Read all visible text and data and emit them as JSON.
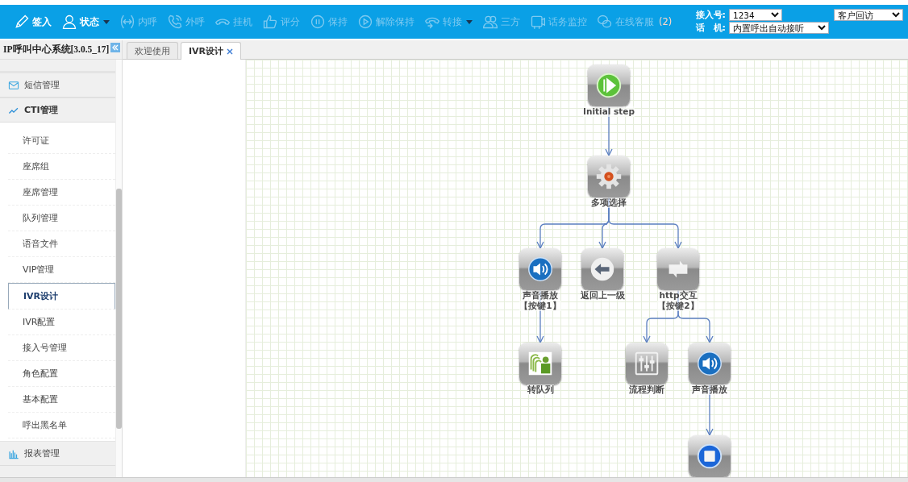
{
  "toolbar": [
    {
      "kind": "pencil",
      "label": "签入",
      "disabled": false,
      "dropdown": false
    },
    {
      "kind": "user",
      "label": "状态",
      "disabled": false,
      "dropdown": true
    },
    {
      "kind": "intercom",
      "label": "内呼",
      "disabled": true,
      "dropdown": false
    },
    {
      "kind": "phone",
      "label": "外呼",
      "disabled": true,
      "dropdown": false
    },
    {
      "kind": "hangup",
      "label": "挂机",
      "disabled": true,
      "dropdown": false
    },
    {
      "kind": "thumb",
      "label": "评分",
      "disabled": true,
      "dropdown": false
    },
    {
      "kind": "pause",
      "label": "保持",
      "disabled": true,
      "dropdown": false
    },
    {
      "kind": "play",
      "label": "解除保持",
      "disabled": true,
      "dropdown": false
    },
    {
      "kind": "transfer",
      "label": "转接",
      "disabled": true,
      "dropdown": true
    },
    {
      "kind": "group",
      "label": "三方",
      "disabled": true,
      "dropdown": false
    },
    {
      "kind": "video",
      "label": "话务监控",
      "disabled": true,
      "dropdown": false
    },
    {
      "kind": "chat",
      "label": "在线客服",
      "disabled": true,
      "dropdown": false,
      "badge": "(2)"
    }
  ],
  "access_number": {
    "label": "接入号:",
    "value": "1234"
  },
  "phone_mode": {
    "label": "话　机:",
    "value": "内置呼出自动接听"
  },
  "mode_select": {
    "value": "客户回访"
  },
  "sidebar": {
    "title": "IP呼叫中心系统[3.0.5_17]",
    "groups": [
      {
        "kind": "sms",
        "label": "短信管理",
        "expanded": false
      },
      {
        "kind": "cti",
        "label": "CTI管理",
        "expanded": true,
        "children": [
          {
            "label": "许可证",
            "selected": false
          },
          {
            "label": "座席组",
            "selected": false
          },
          {
            "label": "座席管理",
            "selected": false
          },
          {
            "label": "队列管理",
            "selected": false
          },
          {
            "label": "语音文件",
            "selected": false
          },
          {
            "label": "VIP管理",
            "selected": false
          },
          {
            "label": "IVR设计",
            "selected": true
          },
          {
            "label": "IVR配置",
            "selected": false
          },
          {
            "label": "接入号管理",
            "selected": false
          },
          {
            "label": "角色配置",
            "selected": false
          },
          {
            "label": "基本配置",
            "selected": false
          },
          {
            "label": "呼出黑名单",
            "selected": false
          }
        ]
      },
      {
        "kind": "report",
        "label": "报表管理",
        "expanded": false
      }
    ]
  },
  "tabs": [
    {
      "label": "欢迎使用",
      "selected": false,
      "closable": false
    },
    {
      "label": "IVR设计",
      "selected": true,
      "closable": true
    }
  ],
  "flow": {
    "root": {
      "kind": "start",
      "label": "Initial step",
      "children": [
        {
          "kind": "menu",
          "label": "多项选择",
          "children": [
            {
              "kind": "sound",
              "label": "声音播放",
              "key": "【按键1】",
              "children": [
                {
                  "kind": "queue",
                  "label": "转队列"
                }
              ]
            },
            {
              "kind": "back",
              "label": "返回上一级"
            },
            {
              "kind": "http",
              "label": "http交互",
              "key": "【按键2】",
              "children": [
                {
                  "kind": "switch",
                  "label": "流程判断"
                },
                {
                  "kind": "sound",
                  "label": "声音播放",
                  "children": [
                    {
                      "kind": "stop"
                    }
                  ]
                }
              ]
            }
          ]
        }
      ]
    }
  }
}
